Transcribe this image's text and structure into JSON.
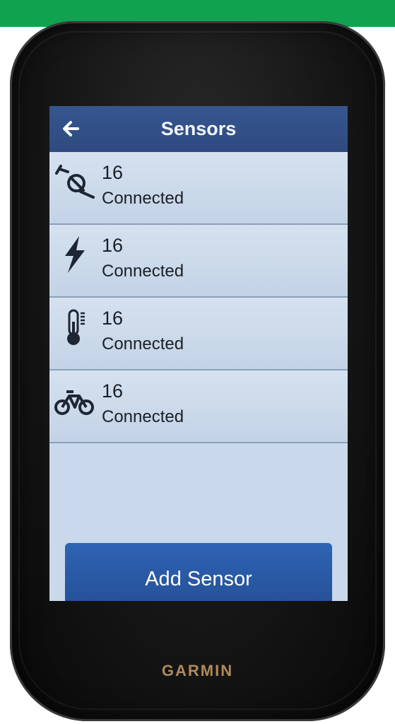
{
  "header": {
    "title": "Sensors",
    "back_icon": "left-arrow-icon"
  },
  "sensors": [
    {
      "icon": "speed-sensor-icon",
      "value": "16",
      "status": "Connected"
    },
    {
      "icon": "power-bolt-icon",
      "value": "16",
      "status": "Connected"
    },
    {
      "icon": "thermometer-icon",
      "value": "16",
      "status": "Connected"
    },
    {
      "icon": "bicycle-icon",
      "value": "16",
      "status": "Connected"
    }
  ],
  "add_button": {
    "label": "Add Sensor"
  },
  "device": {
    "brand": "GARMIN"
  },
  "colors": {
    "accent_strip": "#10a24e",
    "title_bar": "#2f4a80",
    "button": "#2a5aa8"
  }
}
